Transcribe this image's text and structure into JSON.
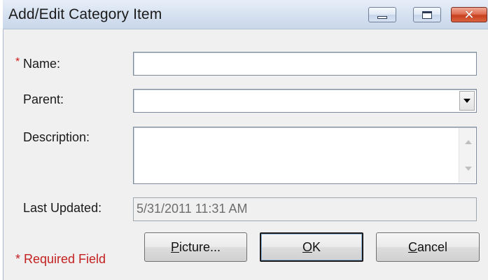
{
  "window": {
    "title": "Add/Edit Category Item",
    "close_glyph": "✕"
  },
  "form": {
    "name": {
      "required_mark": "*",
      "label": "Name:",
      "value": ""
    },
    "parent": {
      "label": "Parent:",
      "value": ""
    },
    "description": {
      "label": "Description:",
      "value": ""
    },
    "last_updated": {
      "label": "Last Updated:",
      "value": "5/31/2011 11:31 AM"
    }
  },
  "footer": {
    "required_note": "* Required Field"
  },
  "buttons": {
    "picture": {
      "first": "P",
      "rest": "icture..."
    },
    "ok": {
      "first": "O",
      "rest": "K"
    },
    "cancel": {
      "first": "C",
      "rest": "ancel"
    }
  },
  "colors": {
    "required": "#c42020",
    "titlebar": "#d8e3f1",
    "close_button": "#c8401f"
  },
  "icons": {
    "minimize": "minimize-icon",
    "maximize": "maximize-icon",
    "close": "close-icon",
    "dropdown": "chevron-down-icon",
    "scroll_up": "scroll-up-icon",
    "scroll_down": "scroll-down-icon"
  }
}
